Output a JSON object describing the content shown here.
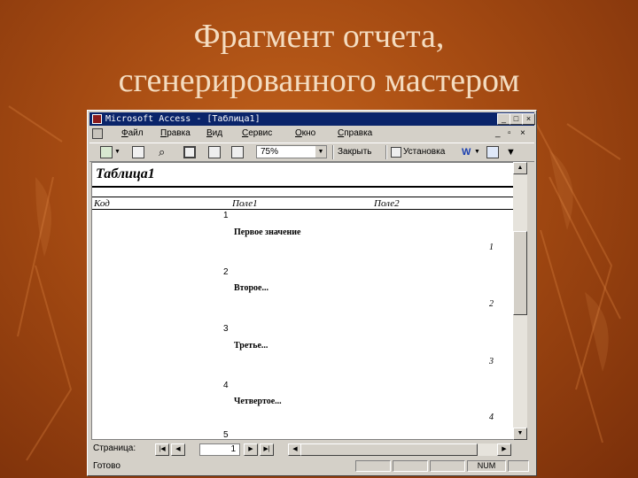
{
  "slide": {
    "title_line1": "Фрагмент отчета,",
    "title_line2": "сгенерированного мастером"
  },
  "window": {
    "title": "Microsoft Access - [Таблица1]"
  },
  "menu": {
    "items": [
      "Файл",
      "Правка",
      "Вид",
      "Сервис",
      "Окно",
      "Справка"
    ]
  },
  "toolbar": {
    "zoom_value": "75%",
    "close_label": "Закрыть",
    "setup_label": "Установка"
  },
  "report": {
    "title": "Таблица1",
    "columns": [
      "Код",
      "Поле1",
      "Поле2"
    ],
    "records": [
      {
        "id": "1",
        "field1": "Первое значение",
        "field2": "1"
      },
      {
        "id": "2",
        "field1": "Второе...",
        "field2": "2"
      },
      {
        "id": "3",
        "field1": "Третье...",
        "field2": "3"
      },
      {
        "id": "4",
        "field1": "Четвертое...",
        "field2": "4"
      },
      {
        "id": "5"
      }
    ]
  },
  "navigation": {
    "page_label": "Страница:",
    "page_value": "1"
  },
  "status": {
    "ready": "Готово",
    "num": "NUM"
  }
}
